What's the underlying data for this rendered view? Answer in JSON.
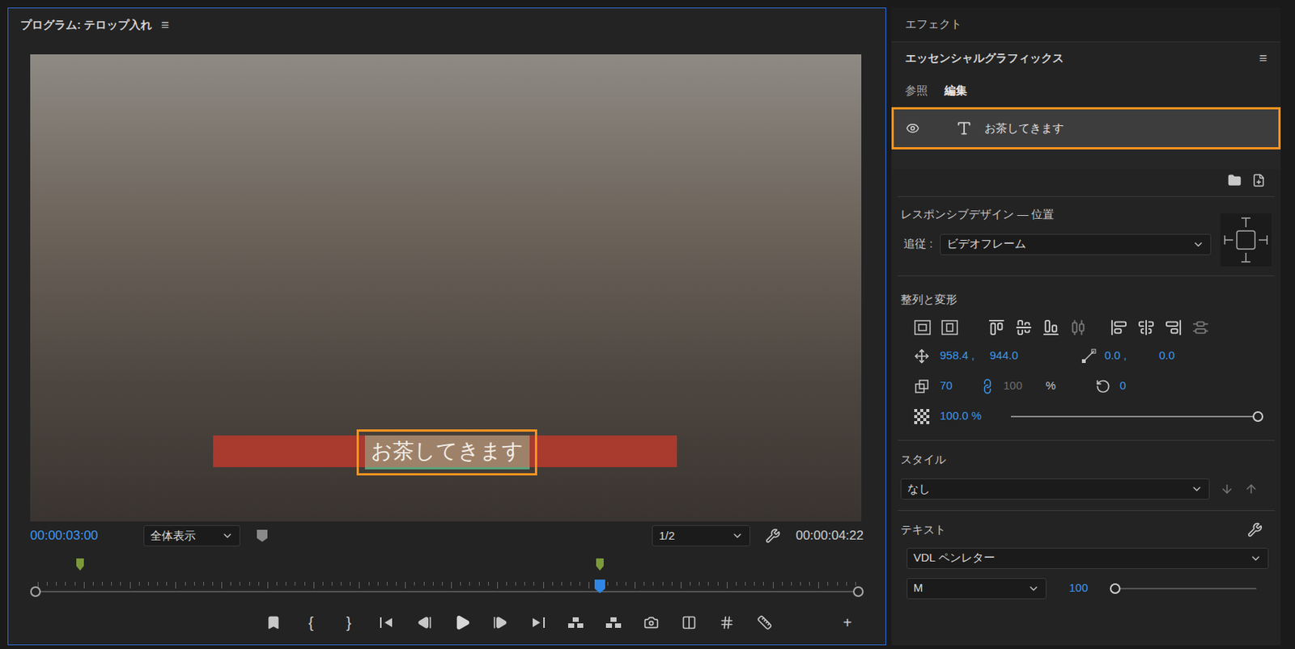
{
  "program": {
    "title": "プログラム: テロップ入れ",
    "menu": "≡",
    "timecode": "00:00:03:00",
    "zoom": "全体表示",
    "resolution": "1/2",
    "duration": "00:00:04:22",
    "playhead": 0.684,
    "markers": [
      0.06,
      0.684
    ],
    "caption": {
      "text": "お茶してきます",
      "selected": true
    }
  },
  "transport": [
    {
      "kind": "marker",
      "label": ""
    },
    {
      "kind": "text",
      "label": "{"
    },
    {
      "kind": "text",
      "label": "}"
    },
    {
      "kind": "go-in",
      "label": ""
    },
    {
      "kind": "step-back",
      "label": ""
    },
    {
      "kind": "play",
      "label": ""
    },
    {
      "kind": "step-forward",
      "label": ""
    },
    {
      "kind": "go-out",
      "label": ""
    },
    {
      "kind": "lift",
      "label": ""
    },
    {
      "kind": "extract",
      "label": ""
    },
    {
      "kind": "camera",
      "label": ""
    },
    {
      "kind": "compare",
      "label": ""
    },
    {
      "kind": "grid",
      "label": ""
    },
    {
      "kind": "ruler",
      "label": ""
    },
    {
      "kind": "text",
      "label": "+"
    }
  ],
  "effects_panel": {
    "title": "エフェクト"
  },
  "graphics_panel": {
    "title": "エッセンシャルグラフィックス",
    "menu": "≡",
    "tabs": [
      {
        "label": "参照",
        "selected": false
      },
      {
        "label": "編集",
        "selected": true
      }
    ],
    "layers": [
      {
        "name": "お茶してきます",
        "visible": true,
        "selected": true
      }
    ],
    "responsive": {
      "title": "レスポンシブデザイン — 位置",
      "follow_label": "追従 :",
      "follow_value": "ビデオフレーム"
    },
    "transform": {
      "title": "整列と変形",
      "position_x": "958.4 ,",
      "position_y": "944.0",
      "anchor_x": "0.0 ,",
      "anchor_y": "0.0",
      "scale": "70",
      "scale_height": "100",
      "scale_unit": "%",
      "uniform_scale": true,
      "rotation": "0",
      "opacity": "100.0 %",
      "opacity_level": 1
    },
    "style": {
      "title": "スタイル",
      "value": "なし"
    },
    "text": {
      "title": "テキスト",
      "font": "VDL ペンレター",
      "weight": "M",
      "size": "100",
      "size_level": 0.03
    }
  }
}
